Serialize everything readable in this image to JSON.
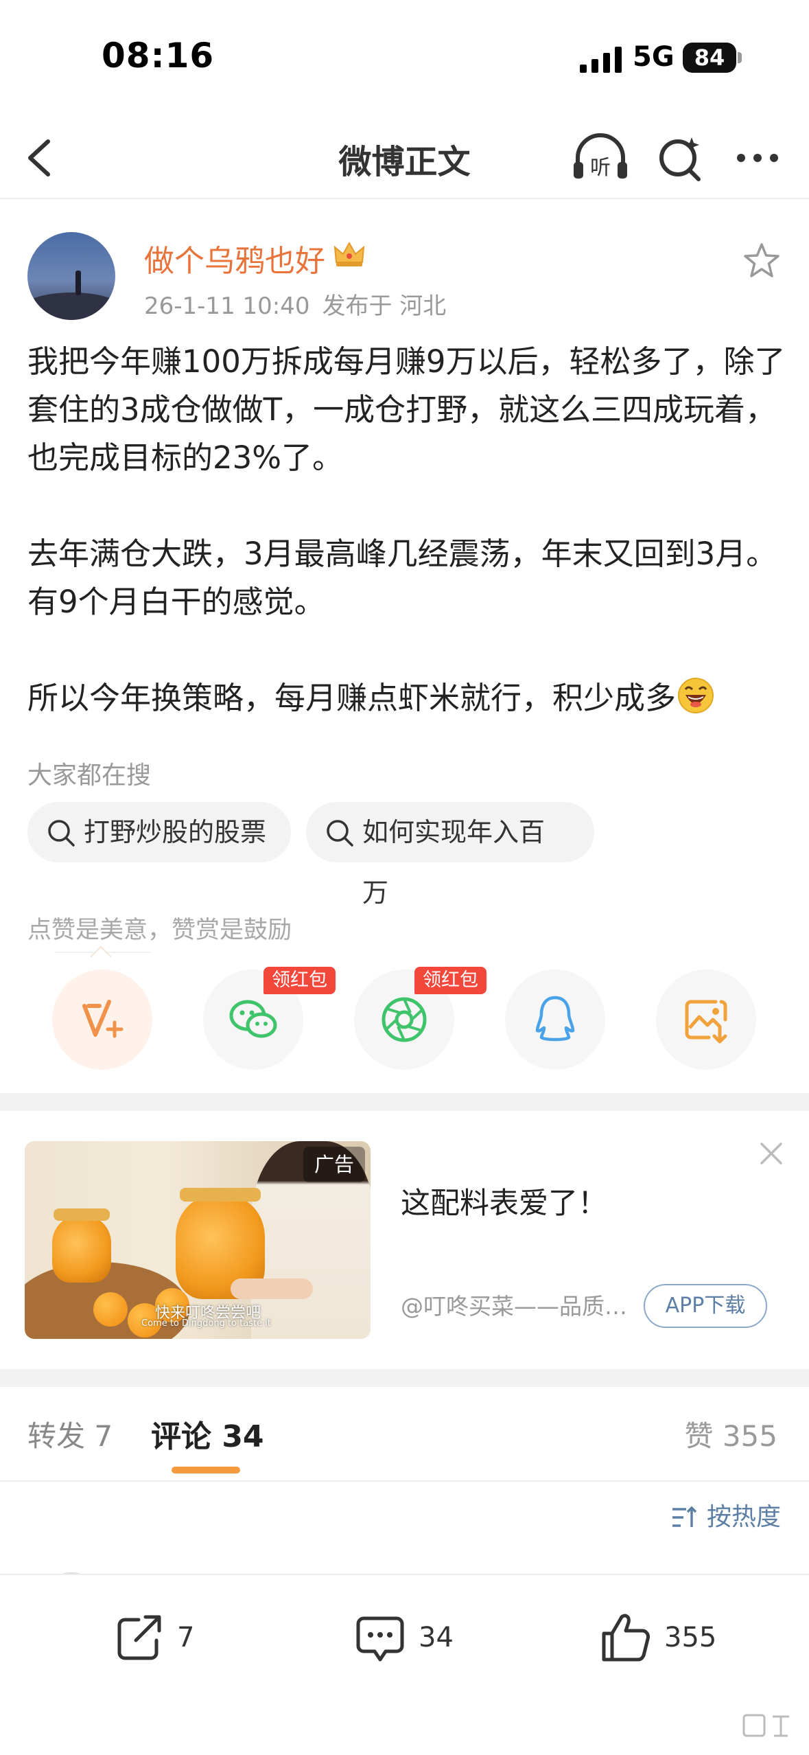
{
  "status_bar": {
    "time": "08:16",
    "network": "5G",
    "battery": "84"
  },
  "nav": {
    "title": "微博正文",
    "listen_label": "听"
  },
  "post": {
    "author": "做个乌鸦也好",
    "timestamp": "26-1-11 10:40",
    "location": "发布于 河北",
    "paragraphs": [
      "我把今年赚100万拆成每月赚9万以后，轻松多了，除了套住的3成仓做做T，一成仓打野，就这么三四成玩着，也完成目标的23%了。",
      "去年满仓大跌，3月最高峰几经震荡，年末又回到3月。有9个月白干的感觉。",
      "所以今年换策略，每月赚点虾米就行，积少成多"
    ]
  },
  "search_suggestions": {
    "title": "大家都在搜",
    "items": [
      "打野炒股的股票",
      "如何实现年入百万"
    ]
  },
  "reward": {
    "title": "点赞是美意，赞赏是鼓励",
    "badge_label": "领红包",
    "share_targets": [
      "reward-v-icon",
      "wechat-icon",
      "moments-icon",
      "qq-icon",
      "save-image-icon"
    ]
  },
  "ad": {
    "tag": "广告",
    "title": "这配料表爱了！",
    "source": "@叮咚买菜——品质…",
    "cta": "APP下载",
    "image_caption": "快来叮咚尝尝吧",
    "image_caption_en": "Come to Dingdong to taste it"
  },
  "tabs": {
    "repost": "转发 7",
    "comment": "评论 34",
    "like": "赞 355"
  },
  "sort_label": "按热度",
  "bottom_bar": {
    "repost_count": "7",
    "comment_count": "34",
    "like_count": "355"
  },
  "colors": {
    "accent_orange": "#e8743b",
    "tab_indicator": "#f39a3e",
    "badge_red": "#f3473b",
    "link_blue": "#5d7fa6",
    "wechat_green": "#3fc36b",
    "qq_blue": "#4aa3e8",
    "save_orange": "#f2a23a"
  }
}
